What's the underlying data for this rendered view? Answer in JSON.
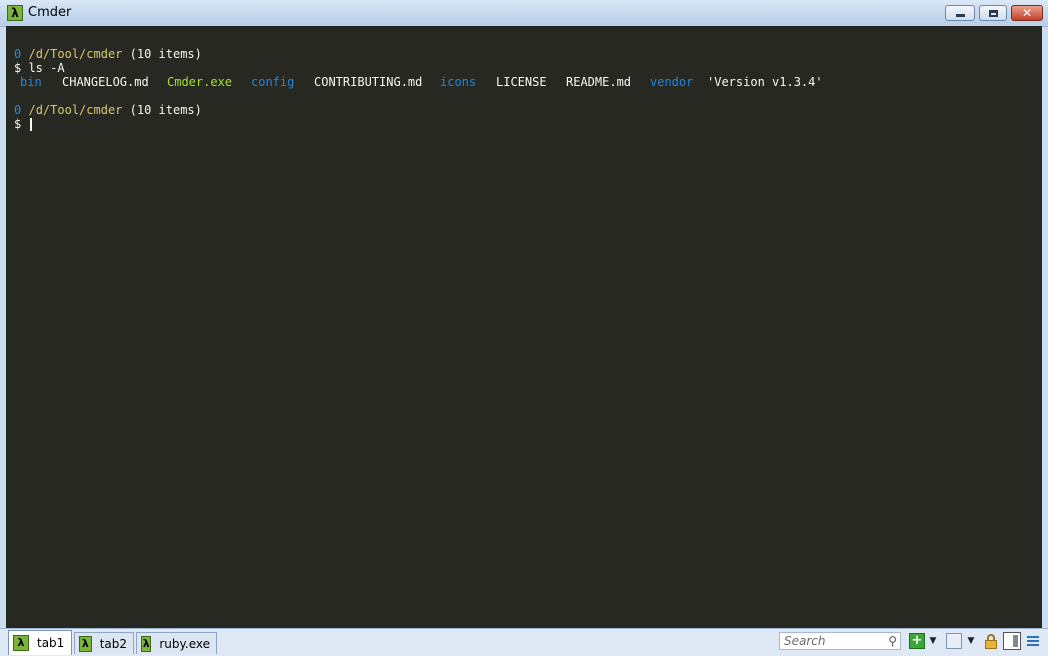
{
  "window": {
    "title": "Cmder",
    "app_icon": "lambda-icon",
    "app_icon_glyph": "λ",
    "close_glyph": "✕"
  },
  "terminal": {
    "lines": [
      {
        "prompt_num": "0",
        "path": "/d/Tool/cmder",
        "info": "(10 items)"
      },
      {
        "cmd": "$ ls -A"
      },
      {
        "ls_items": [
          {
            "name": "bin",
            "color": "#1e88e5"
          },
          {
            "name": "CHANGELOG.md",
            "color": "#f8f8f2"
          },
          {
            "name": "Cmder.exe",
            "color": "#a6e22e"
          },
          {
            "name": "config",
            "color": "#1e88e5"
          },
          {
            "name": "CONTRIBUTING.md",
            "color": "#f8f8f2"
          },
          {
            "name": "icons",
            "color": "#1e88e5"
          },
          {
            "name": "LICENSE",
            "color": "#f8f8f2"
          },
          {
            "name": "README.md",
            "color": "#f8f8f2"
          },
          {
            "name": "vendor",
            "color": "#1e88e5"
          },
          {
            "name": "'Version v1.3.4'",
            "color": "#f8f8f2"
          }
        ]
      },
      {
        "prompt_num": "0",
        "path": "/d/Tool/cmder",
        "info": "(10 items)"
      },
      {
        "cmd": "$ "
      }
    ],
    "background": "#272822"
  },
  "tabs": [
    {
      "label": "tab1",
      "active": true
    },
    {
      "label": "tab2",
      "active": false
    },
    {
      "label": "ruby.exe",
      "active": false
    }
  ],
  "toolbar": {
    "search_placeholder": "Search",
    "icons": [
      "search-icon",
      "new-console-plus-icon",
      "dropdown-arrow-icon",
      "window-icon",
      "dropdown-arrow-icon",
      "lock-icon",
      "panel-icon",
      "menu-icon"
    ]
  },
  "colors": {
    "accent": "#7ab43a",
    "prompt_num": "#1e88e5",
    "path": "#d7c96a",
    "executable": "#a6e22e",
    "directory": "#1e88e5"
  }
}
